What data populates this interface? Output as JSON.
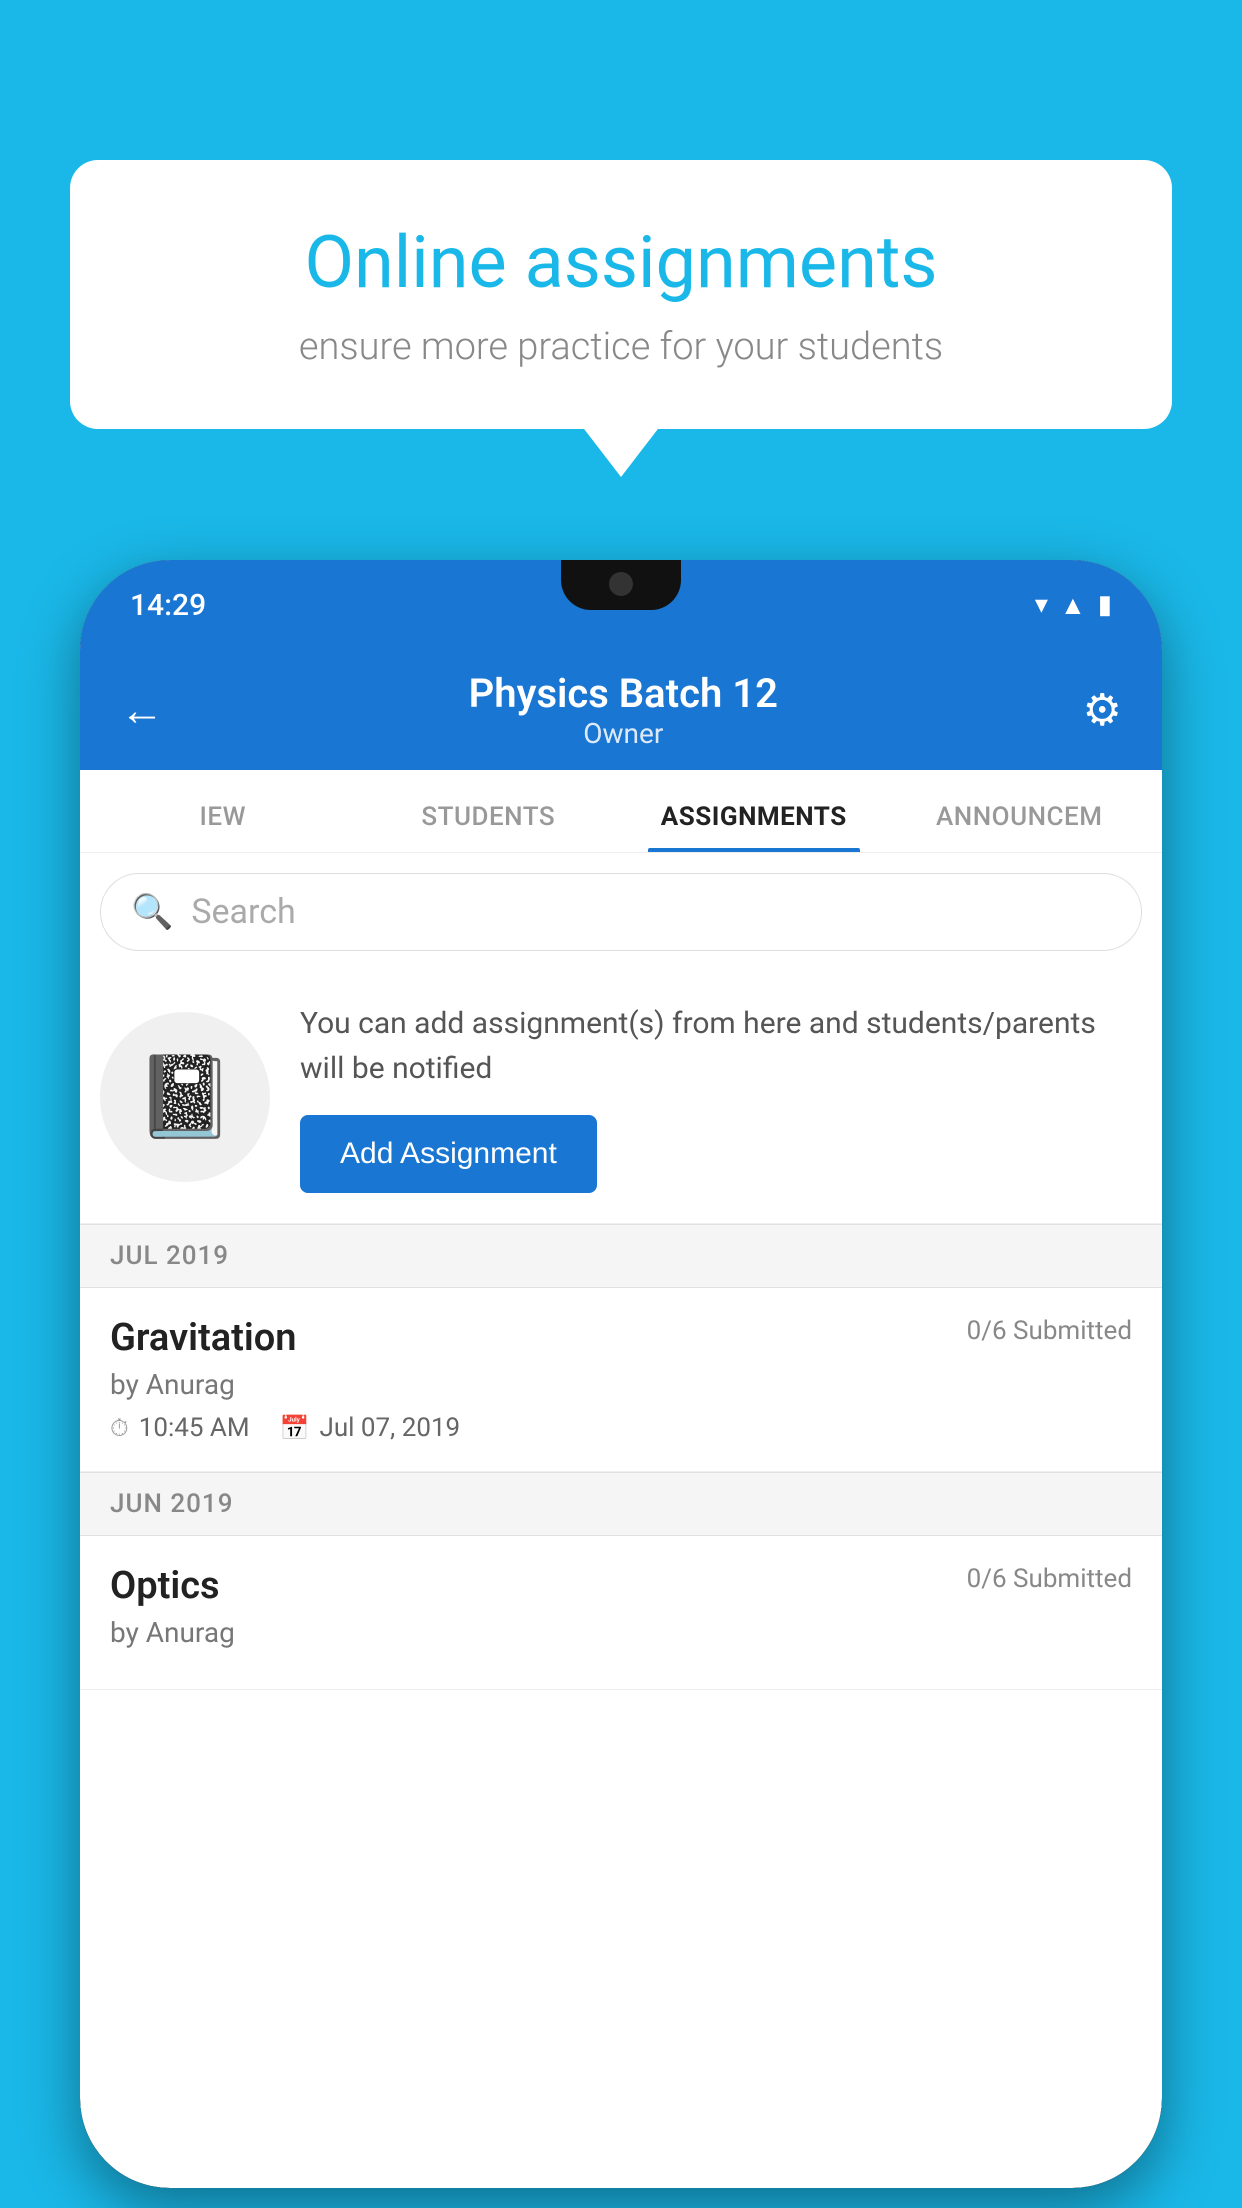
{
  "background_color": "#1ab8e8",
  "speech_bubble": {
    "title": "Online assignments",
    "subtitle": "ensure more practice for your students"
  },
  "phone": {
    "status_bar": {
      "time": "14:29",
      "icons": [
        "wifi",
        "signal",
        "battery"
      ]
    },
    "app_header": {
      "title": "Physics Batch 12",
      "subtitle": "Owner",
      "back_icon": "←",
      "settings_icon": "⚙"
    },
    "tabs": [
      {
        "label": "IEW",
        "active": false
      },
      {
        "label": "STUDENTS",
        "active": false
      },
      {
        "label": "ASSIGNMENTS",
        "active": true
      },
      {
        "label": "ANNOUNCEM",
        "active": false
      }
    ],
    "search": {
      "placeholder": "Search"
    },
    "promo": {
      "description": "You can add assignment(s) from here and students/parents will be notified",
      "button_label": "Add Assignment"
    },
    "sections": [
      {
        "month_label": "JUL 2019",
        "assignments": [
          {
            "name": "Gravitation",
            "submitted": "0/6 Submitted",
            "author": "by Anurag",
            "time": "10:45 AM",
            "date": "Jul 07, 2019"
          }
        ]
      },
      {
        "month_label": "JUN 2019",
        "assignments": [
          {
            "name": "Optics",
            "submitted": "0/6 Submitted",
            "author": "by Anurag",
            "time": "",
            "date": ""
          }
        ]
      }
    ]
  }
}
